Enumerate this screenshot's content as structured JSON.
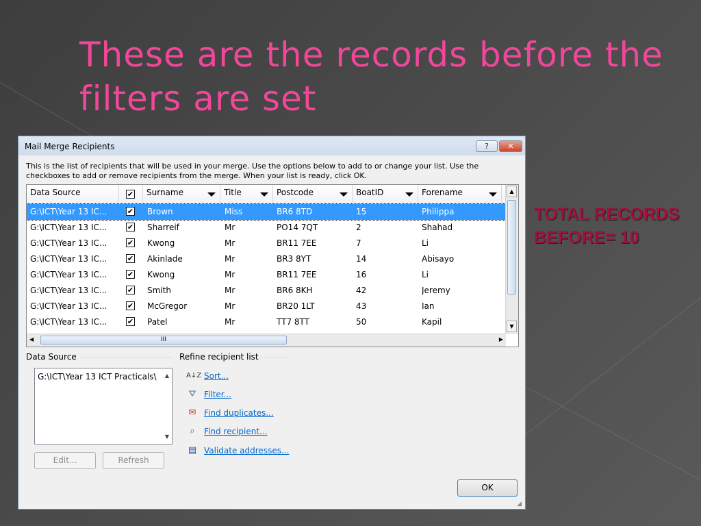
{
  "slide": {
    "title": "These are the records before the filters are set",
    "side_note": "TOTAL RECORDS BEFORE= 10"
  },
  "dialog": {
    "title": "Mail Merge Recipients",
    "help_label": "?",
    "close_label": "✕",
    "instructions": "This is the list of recipients that will be used in your merge.  Use the options below to add to or change your list.  Use the checkboxes to add or remove recipients from the merge.  When your list is ready, click OK.",
    "columns": [
      "Data Source",
      "",
      "Surname",
      "Title",
      "Postcode",
      "BoatID",
      "Forename"
    ],
    "rows": [
      {
        "source": "G:\\ICT\\Year 13 IC...",
        "checked": "✔",
        "surname": "Brown",
        "title": "Miss",
        "postcode": "BR6 8TD",
        "boatid": "15",
        "forename": "Philippa"
      },
      {
        "source": "G:\\ICT\\Year 13 IC...",
        "checked": "✔",
        "surname": "Sharreif",
        "title": "Mr",
        "postcode": "PO14 7QT",
        "boatid": "2",
        "forename": "Shahad"
      },
      {
        "source": "G:\\ICT\\Year 13 IC...",
        "checked": "✔",
        "surname": "Kwong",
        "title": "Mr",
        "postcode": "BR11 7EE",
        "boatid": "7",
        "forename": "Li"
      },
      {
        "source": "G:\\ICT\\Year 13 IC...",
        "checked": "✔",
        "surname": "Akinlade",
        "title": "Mr",
        "postcode": "BR3 8YT",
        "boatid": "14",
        "forename": "Abisayo"
      },
      {
        "source": "G:\\ICT\\Year 13 IC...",
        "checked": "✔",
        "surname": "Kwong",
        "title": "Mr",
        "postcode": "BR11 7EE",
        "boatid": "16",
        "forename": "Li"
      },
      {
        "source": "G:\\ICT\\Year 13 IC...",
        "checked": "✔",
        "surname": "Smith",
        "title": "Mr",
        "postcode": "BR6 8KH",
        "boatid": "42",
        "forename": "Jeremy"
      },
      {
        "source": "G:\\ICT\\Year 13 IC...",
        "checked": "✔",
        "surname": "McGregor",
        "title": "Mr",
        "postcode": "BR20 1LT",
        "boatid": "43",
        "forename": "Ian"
      },
      {
        "source": "G:\\ICT\\Year 13 IC...",
        "checked": "✔",
        "surname": "Patel",
        "title": "Mr",
        "postcode": "TT7 8TT",
        "boatid": "50",
        "forename": "Kapil"
      }
    ],
    "hscroll_thumb_label": "III",
    "data_source_label": "Data Source",
    "data_source_item": "G:\\ICT\\Year 13 ICT Practicals\\",
    "refine_label": "Refine recipient list",
    "refine_links": [
      {
        "label": "Sort...",
        "icon": "sort-icon"
      },
      {
        "label": "Filter...",
        "icon": "filter-icon"
      },
      {
        "label": "Find duplicates...",
        "icon": "duplicates-icon"
      },
      {
        "label": "Find recipient...",
        "icon": "find-recipient-icon"
      },
      {
        "label": "Validate addresses...",
        "icon": "validate-icon"
      }
    ],
    "edit_label": "Edit...",
    "refresh_label": "Refresh",
    "ok_label": "OK"
  }
}
